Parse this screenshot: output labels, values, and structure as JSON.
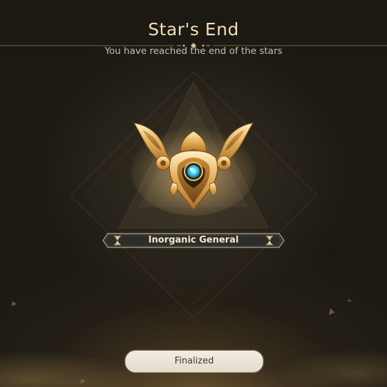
{
  "header": {
    "title": "Star's End",
    "subtitle": "You have reached the end of the stars"
  },
  "badge": {
    "title": "Inorganic General",
    "icon": "general-emblem-icon"
  },
  "actions": {
    "finalize_label": "Finalized"
  },
  "colors": {
    "gold": "#e8b764",
    "title_text": "#f1dfb6",
    "gem": "#4fe2ff",
    "button_bg": "#eeeae0"
  }
}
